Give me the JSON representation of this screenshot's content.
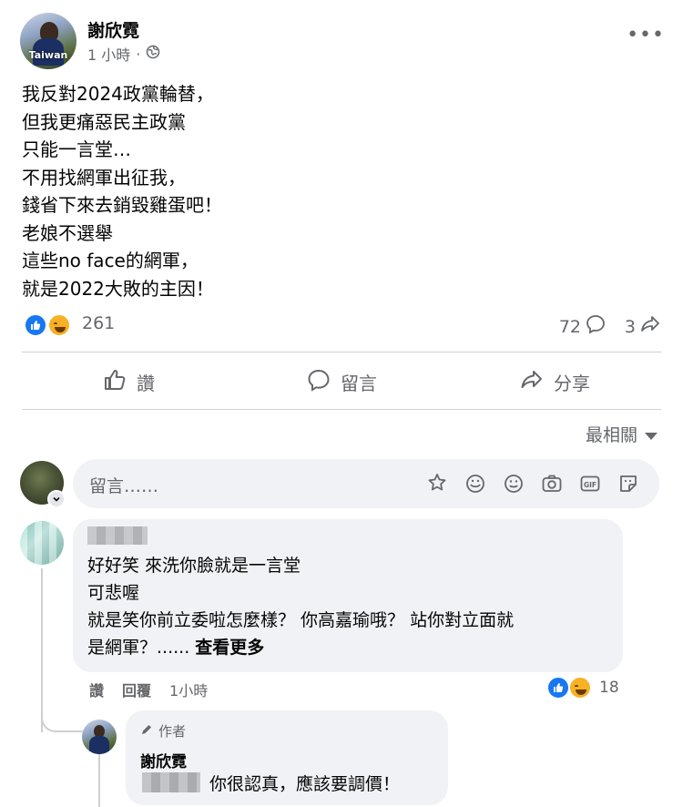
{
  "post": {
    "author": "謝欣霓",
    "time": "1 小時",
    "audience_icon": "globe-icon",
    "avatar_badge": "Taiwan",
    "body_lines": [
      "我反對2024政黨輪替，",
      "但我更痛惡民主政黨",
      "只能一言堂…",
      "不用找網軍出征我，",
      "錢省下來去銷毀雞蛋吧！",
      "老娘不選舉",
      "這些no face的網軍，",
      "就是2022大敗的主因！"
    ],
    "reaction_count": "261",
    "comment_count": "72",
    "share_count": "3"
  },
  "actions": {
    "like": "讚",
    "comment": "留言",
    "share": "分享"
  },
  "sort_label": "最相關",
  "comment_box": {
    "placeholder": "留言……"
  },
  "comments": [
    {
      "lines": [
        "好好笑 來洗你臉就是一言堂",
        "可悲喔",
        "就是笑你前立委啦怎麼樣？ 你高嘉瑜哦？ 站你對立面就",
        "是網軍？......"
      ],
      "see_more": "查看更多",
      "like_label": "讚",
      "reply_label": "回覆",
      "time": "1小時",
      "reaction_count": "18"
    }
  ],
  "reply": {
    "badge": "作者",
    "author": "謝欣霓",
    "text": "你很認真，應該要調價！"
  },
  "colors": {
    "accent": "#1877f2",
    "haha": "#f7b125",
    "muted": "#65676b",
    "bubble": "#f0f2f5"
  }
}
